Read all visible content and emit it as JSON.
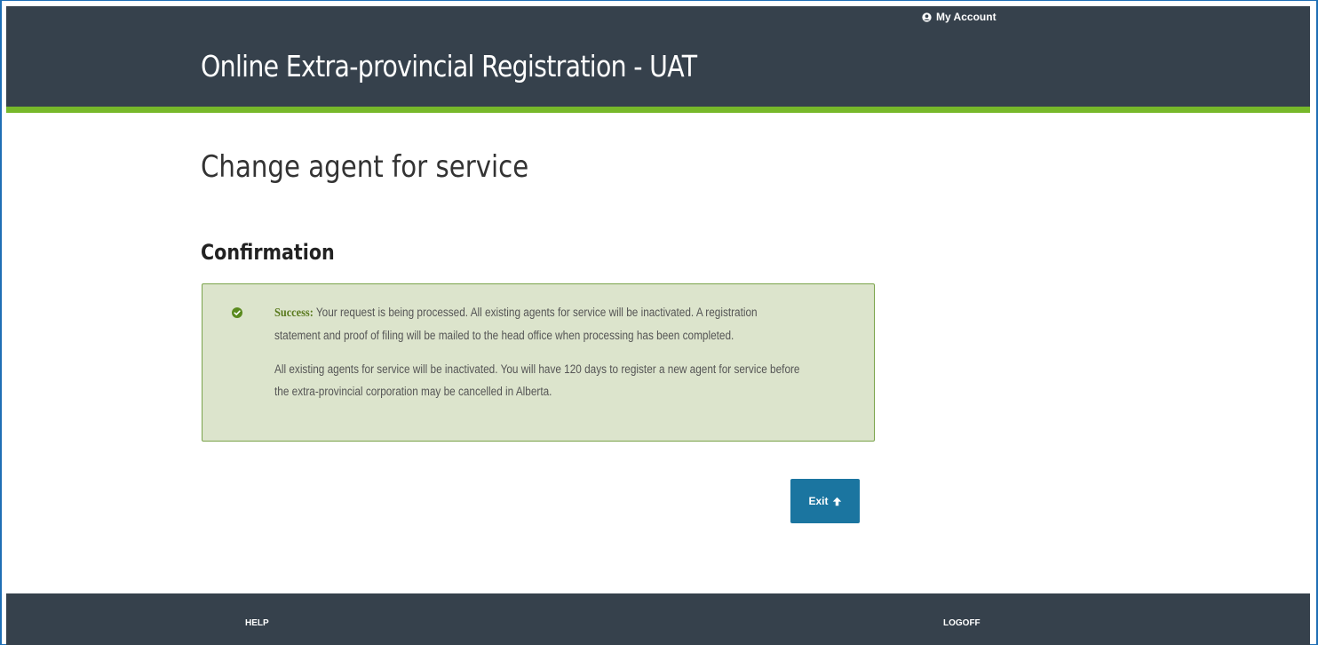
{
  "header": {
    "app_title": "Online Extra-provincial Registration - UAT",
    "my_account_label": "My Account",
    "user_icon": "user-circle-icon"
  },
  "main": {
    "page_title": "Change agent for service",
    "section_title": "Confirmation",
    "alert": {
      "status_icon": "check-circle-icon",
      "label": "Success:",
      "message_1": "Your request is being processed. All existing agents for service will be inactivated. A registration statement and proof of filing will be mailed to the head office when processing has been completed.",
      "message_2": "All existing agents for service will be inactivated. You will have 120 days to register a new agent for service before the extra-provincial corporation may be cancelled in Alberta."
    },
    "exit_button": {
      "label": "Exit",
      "icon": "arrow-up-icon"
    }
  },
  "footer": {
    "help_label": "HELP",
    "logoff_label": "LOGOFF"
  },
  "colors": {
    "header_bg": "#36414c",
    "accent_green": "#77b82a",
    "alert_bg": "#dce4cc",
    "alert_border": "#7aa34a",
    "success_text": "#5a7a1e",
    "button_blue": "#1b75a0"
  }
}
